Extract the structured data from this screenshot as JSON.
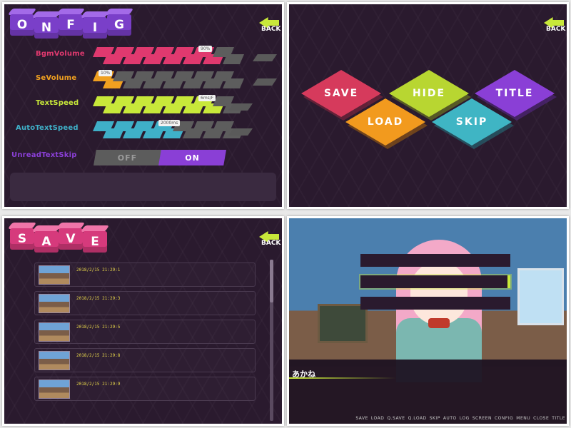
{
  "config": {
    "title_letters": [
      "O",
      "N",
      "F",
      "I",
      "G"
    ],
    "back_label": "BACK",
    "rows": [
      {
        "label": "BgmVolume",
        "color": "#e0396f",
        "value_text": "90%",
        "level": 0.9
      },
      {
        "label": "SeVolume",
        "color": "#f0a020",
        "value_text": "10%",
        "level": 0.1
      },
      {
        "label": "TextSpeed",
        "color": "#c8e83a",
        "value_text": "6ms/F",
        "level": 0.85
      },
      {
        "label": "AutoTextSpeed",
        "color": "#3fb0c8",
        "value_text": "2000ms",
        "level": 0.55
      }
    ],
    "skip_label": "UnreadTextSkip",
    "toggle_off": "OFF",
    "toggle_on": "ON",
    "toggle_state": "ON"
  },
  "menu": {
    "back_label": "BACK",
    "buttons": [
      {
        "label": "SAVE",
        "color": "#d63a5c"
      },
      {
        "label": "HIDE",
        "color": "#b8d631"
      },
      {
        "label": "TITLE",
        "color": "#8a3fd6"
      },
      {
        "label": "LOAD",
        "color": "#f29a1e"
      },
      {
        "label": "SKIP",
        "color": "#3fb5c4"
      }
    ]
  },
  "save": {
    "title_letters": [
      "S",
      "A",
      "V",
      "E"
    ],
    "back_label": "BACK",
    "slots": [
      {
        "date": "2018/2/15  21:29:1"
      },
      {
        "date": "2018/2/15  21:29:3"
      },
      {
        "date": "2018/2/15  21:29:5"
      },
      {
        "date": "2018/2/15  21:29:8"
      },
      {
        "date": "2018/2/15  21:29:9"
      }
    ]
  },
  "game": {
    "speaker": "あかね",
    "choices": 3,
    "quick_menu": [
      "SAVE",
      "LOAD",
      "Q.SAVE",
      "Q.LOAD",
      "SKIP",
      "AUTO",
      "LOG",
      "SCREEN",
      "CONFIG",
      "MENU",
      "CLOSE",
      "TITLE"
    ]
  }
}
